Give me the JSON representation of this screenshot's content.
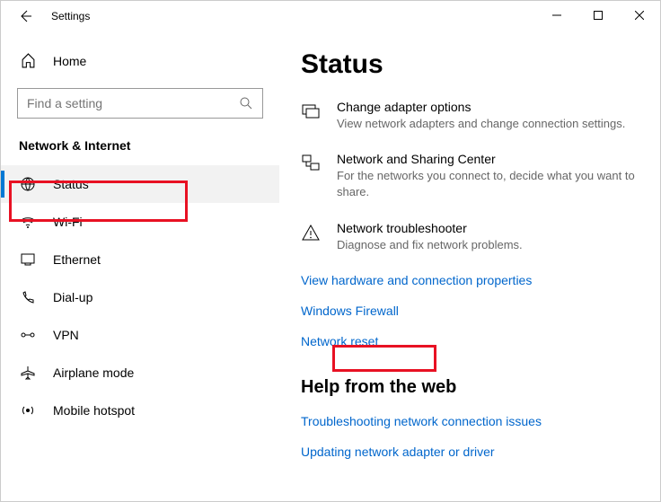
{
  "titlebar": {
    "title": "Settings"
  },
  "sidebar": {
    "home": "Home",
    "search_placeholder": "Find a setting",
    "section": "Network & Internet",
    "items": [
      {
        "label": "Status"
      },
      {
        "label": "Wi-Fi"
      },
      {
        "label": "Ethernet"
      },
      {
        "label": "Dial-up"
      },
      {
        "label": "VPN"
      },
      {
        "label": "Airplane mode"
      },
      {
        "label": "Mobile hotspot"
      }
    ]
  },
  "content": {
    "title": "Status",
    "rows": [
      {
        "title": "Change adapter options",
        "desc": "View network adapters and change connection settings."
      },
      {
        "title": "Network and Sharing Center",
        "desc": "For the networks you connect to, decide what you want to share."
      },
      {
        "title": "Network troubleshooter",
        "desc": "Diagnose and fix network problems."
      }
    ],
    "links": [
      "View hardware and connection properties",
      "Windows Firewall",
      "Network reset"
    ],
    "help_header": "Help from the web",
    "help_links": [
      "Troubleshooting network connection issues",
      "Updating network adapter or driver"
    ]
  }
}
